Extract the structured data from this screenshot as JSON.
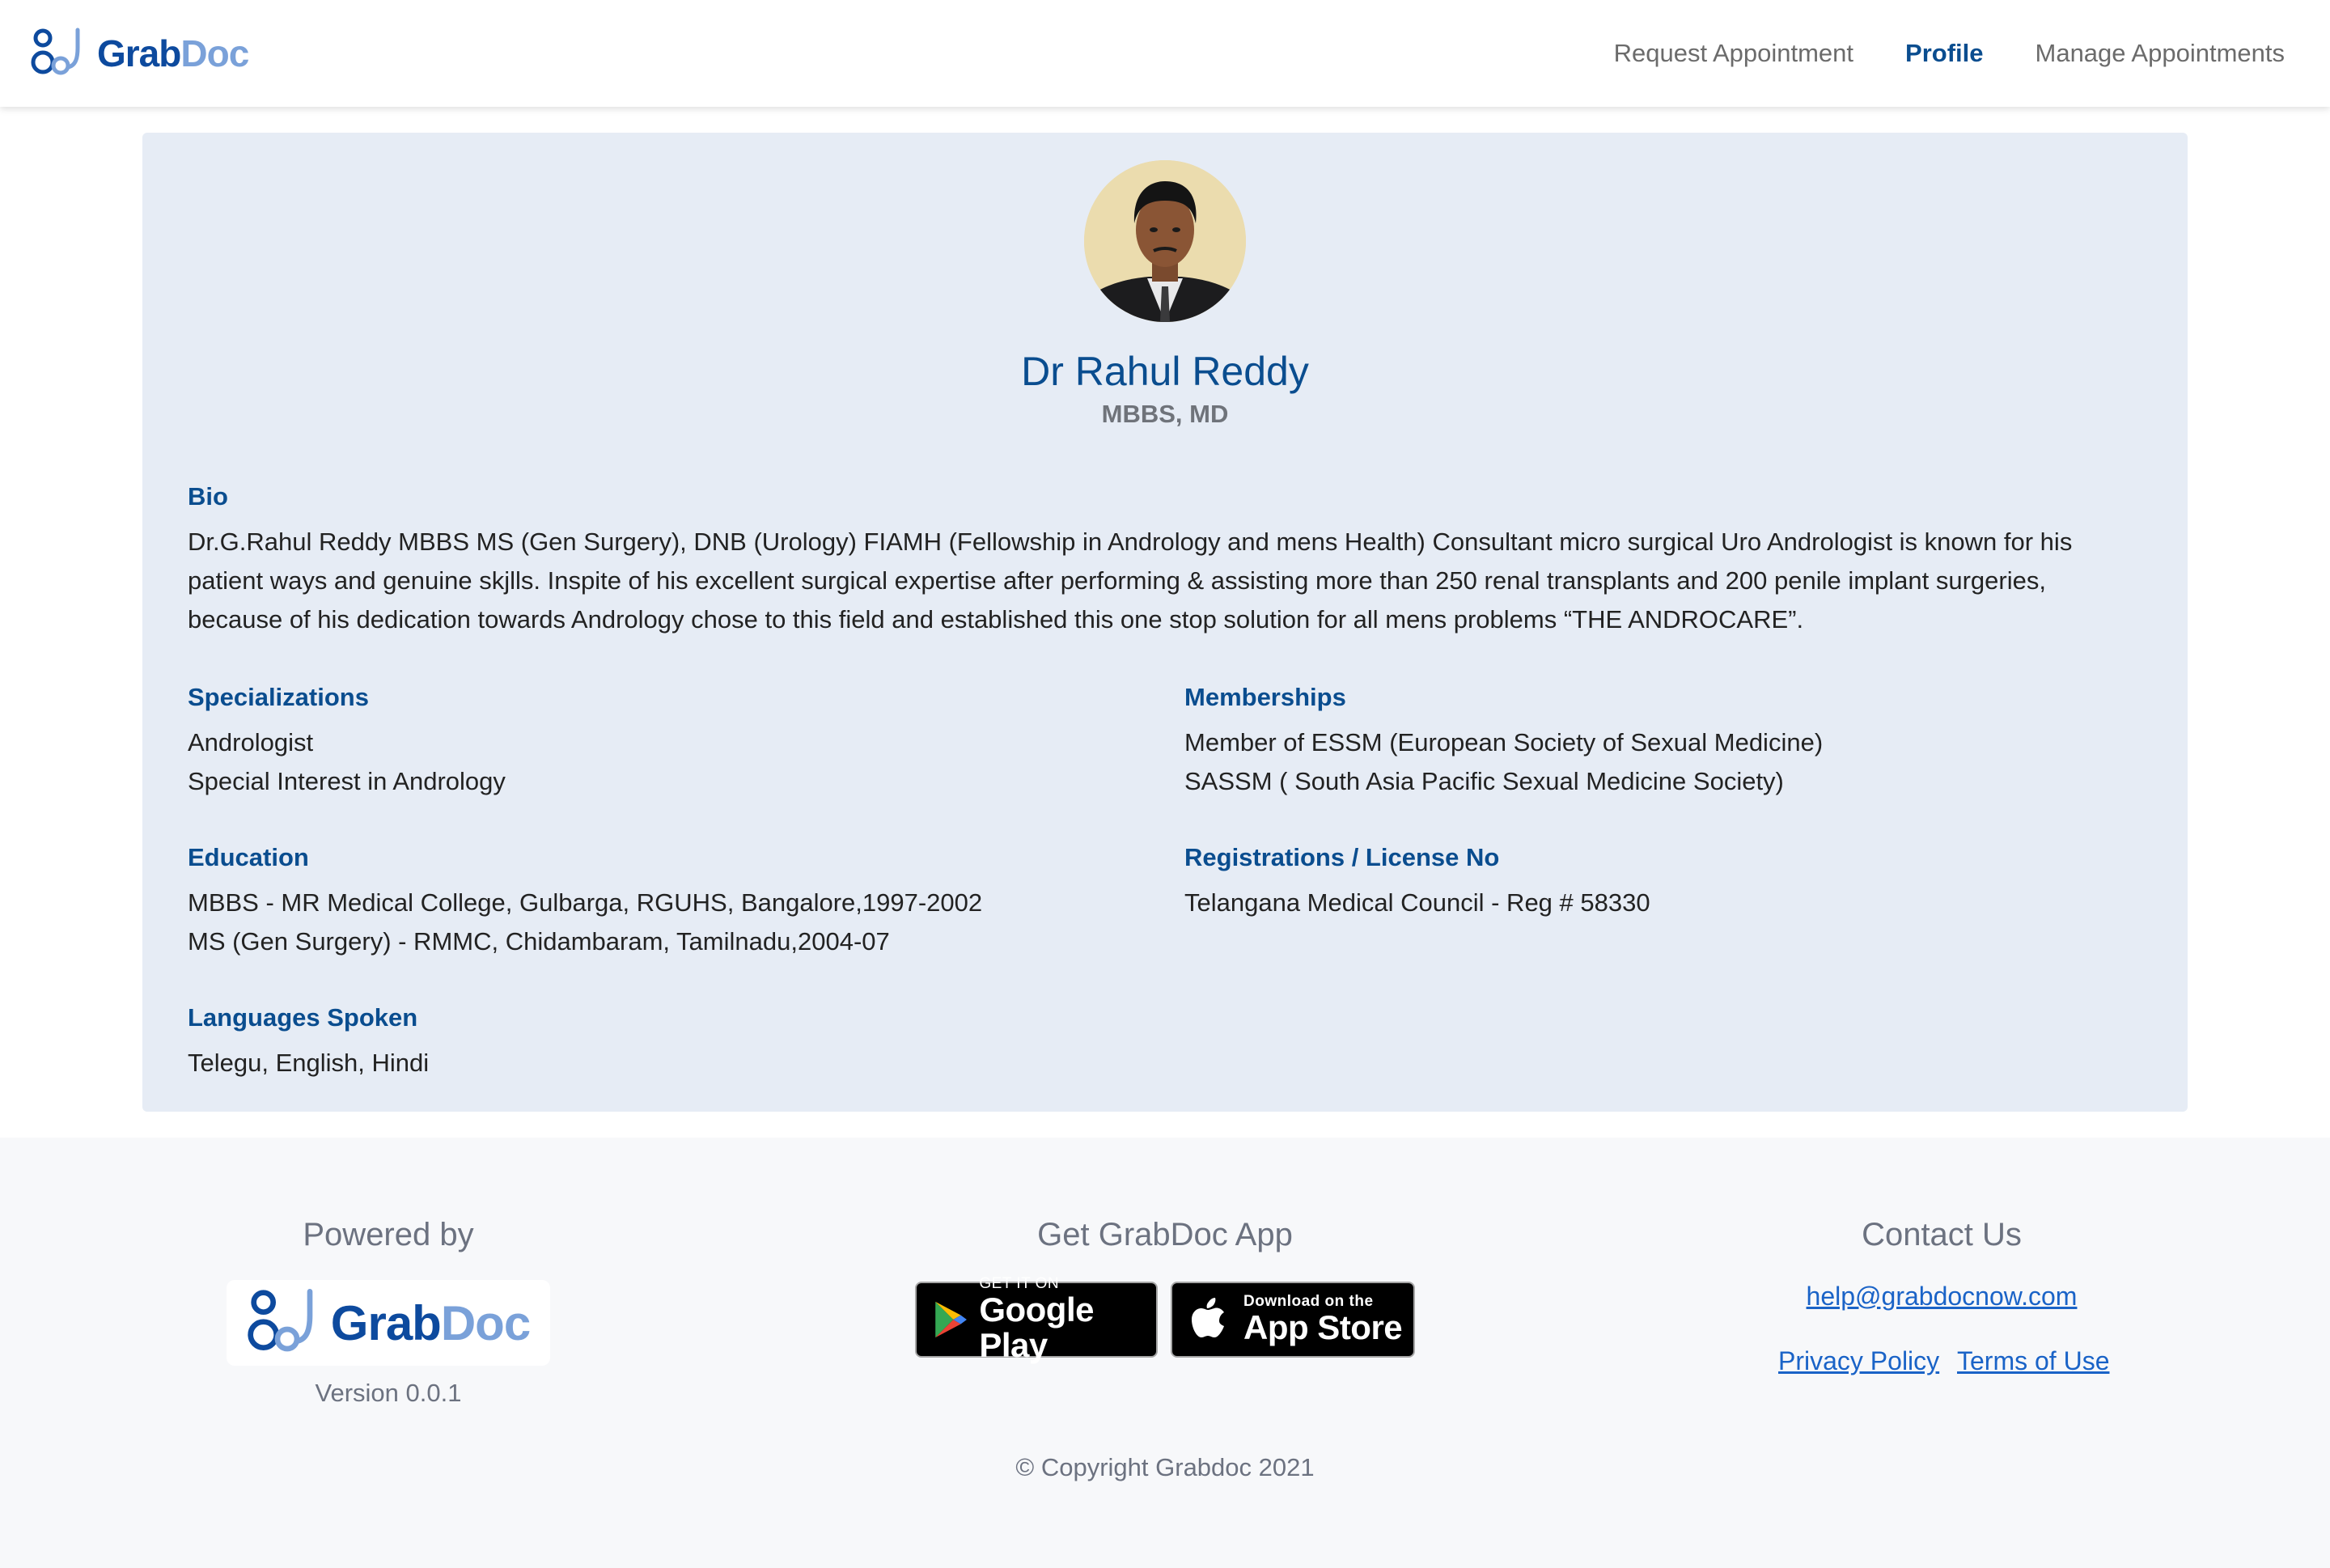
{
  "header": {
    "brand_grab": "Grab",
    "brand_doc": "Doc",
    "nav": [
      {
        "label": "Request Appointment",
        "active": false
      },
      {
        "label": "Profile",
        "active": true
      },
      {
        "label": "Manage Appointments",
        "active": false
      }
    ]
  },
  "profile": {
    "name": "Dr Rahul Reddy",
    "degree": "MBBS, MD",
    "bio_title": "Bio",
    "bio_lines": [
      "Dr.G.Rahul Reddy MBBS MS (Gen Surgery), DNB (Urology) FIAMH (Fellowship in Andrology and mens Health) Consultant micro surgical Uro Andrologist is known for his",
      "patient ways and genuine skjlls. Inspite of his excellent surgical expertise after performing & assisting more than 250 renal transplants and 200 penile implant surgeries,",
      "because of his dedication towards Andrology chose to this field and established this one stop solution for all mens problems “THE ANDROCARE”."
    ],
    "specializations_title": "Specializations",
    "specializations": [
      "Andrologist",
      "Special Interest in Andrology"
    ],
    "memberships_title": "Memberships",
    "memberships": [
      "Member of ESSM (European Society of Sexual Medicine)",
      "SASSM ( South Asia Pacific Sexual Medicine Society)"
    ],
    "education_title": "Education",
    "education": [
      "MBBS - MR Medical College, Gulbarga, RGUHS, Bangalore,1997-2002",
      "MS (Gen Surgery) - RMMC, Chidambaram, Tamilnadu,2004-07"
    ],
    "registrations_title": "Registrations / License No",
    "registrations": [
      "Telangana Medical Council - Reg # 58330"
    ],
    "languages_title": "Languages Spoken",
    "languages": "Telegu, English, Hindi"
  },
  "footer": {
    "powered_title": "Powered by",
    "version": "Version 0.0.1",
    "app_title": "Get GrabDoc App",
    "google_small": "GET IT ON",
    "google_big": "Google Play",
    "apple_small": "Download on the",
    "apple_big": "App Store",
    "contact_title": "Contact Us",
    "email": "help@grabdocnow.com",
    "privacy": "Privacy Policy",
    "terms": "Terms of Use",
    "copyright": "© Copyright Grabdoc 2021"
  },
  "colors": {
    "brand_dark": "#0d4a9e",
    "brand_light": "#7aa1d9",
    "accent": "#0a4d8f",
    "card_bg": "#e6ecf5",
    "footer_bg": "#f7f8fa",
    "link": "#1a63c7"
  }
}
